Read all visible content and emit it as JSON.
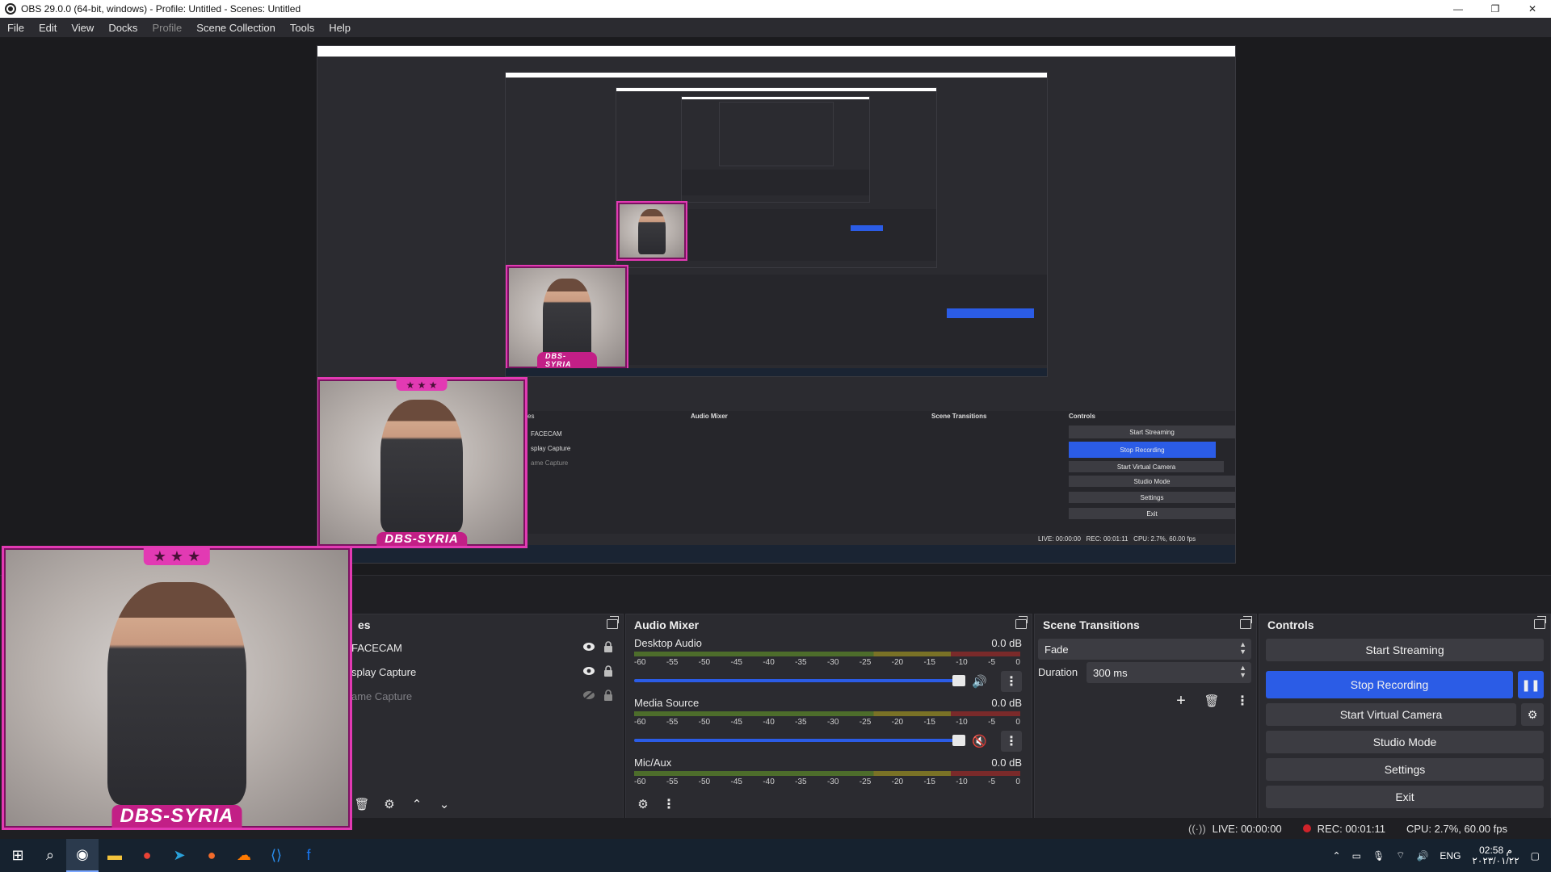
{
  "window": {
    "title": "OBS 29.0.0 (64-bit, windows) - Profile: Untitled - Scenes: Untitled",
    "minimize_glyph": "—",
    "restore_glyph": "❐",
    "close_glyph": "✕"
  },
  "menu": {
    "file": "File",
    "edit": "Edit",
    "view": "View",
    "docks": "Docks",
    "profile": "Profile",
    "scene_collection": "Scene Collection",
    "tools": "Tools",
    "help": "Help"
  },
  "preview": {
    "facecam_label": "DBS-SYRIA",
    "stars": "★ ★ ★",
    "nested_docks": {
      "sources": "es",
      "audio_mixer": "Audio Mixer",
      "scene_transitions": "Scene Transitions",
      "controls": "Controls"
    },
    "nested_sources": [
      "FACECAM",
      "splay Capture",
      "ame Capture"
    ],
    "nested_controls": [
      "Start Streaming",
      "Stop Recording",
      "Start Virtual Camera",
      "Studio Mode",
      "Settings",
      "Exit"
    ],
    "nested_status": {
      "live": "LIVE: 00:00:00",
      "rec": "REC: 00:01:11",
      "cpu": "CPU: 2.7%, 60.00 fps"
    }
  },
  "sources_dock": {
    "title": "es",
    "items": [
      {
        "label": "FACECAM",
        "visible": true
      },
      {
        "label": "splay Capture",
        "visible": true
      },
      {
        "label": "ame Capture",
        "visible": false
      }
    ]
  },
  "audio_mixer": {
    "title": "Audio Mixer",
    "ticks": [
      "-60",
      "-55",
      "-50",
      "-45",
      "-40",
      "-35",
      "-30",
      "-25",
      "-20",
      "-15",
      "-10",
      "-5",
      "0"
    ],
    "channels": [
      {
        "name": "Desktop Audio",
        "db": "0.0 dB",
        "muted": false
      },
      {
        "name": "Media Source",
        "db": "0.0 dB",
        "muted": true
      },
      {
        "name": "Mic/Aux",
        "db": "0.0 dB",
        "muted": false
      }
    ]
  },
  "scene_transitions": {
    "title": "Scene Transitions",
    "transition": "Fade",
    "duration_label": "Duration",
    "duration_value": "300 ms"
  },
  "controls": {
    "title": "Controls",
    "start_streaming": "Start Streaming",
    "stop_recording": "Stop Recording",
    "start_virtual_camera": "Start Virtual Camera",
    "studio_mode": "Studio Mode",
    "settings": "Settings",
    "exit": "Exit"
  },
  "status": {
    "live": "LIVE: 00:00:00",
    "rec": "REC: 00:01:11",
    "cpu": "CPU: 2.7%, 60.00 fps"
  },
  "taskbar": {
    "lang": "ENG",
    "time": "02:58 م",
    "date": "٢٠٢٣/٠١/٢٢"
  },
  "colors": {
    "accent": "#2b5ce6",
    "facecam_border": "#e23ab3",
    "rec_dot": "#d0232a",
    "bg": "#1f1f23",
    "dock_bg": "#2b2b30"
  }
}
